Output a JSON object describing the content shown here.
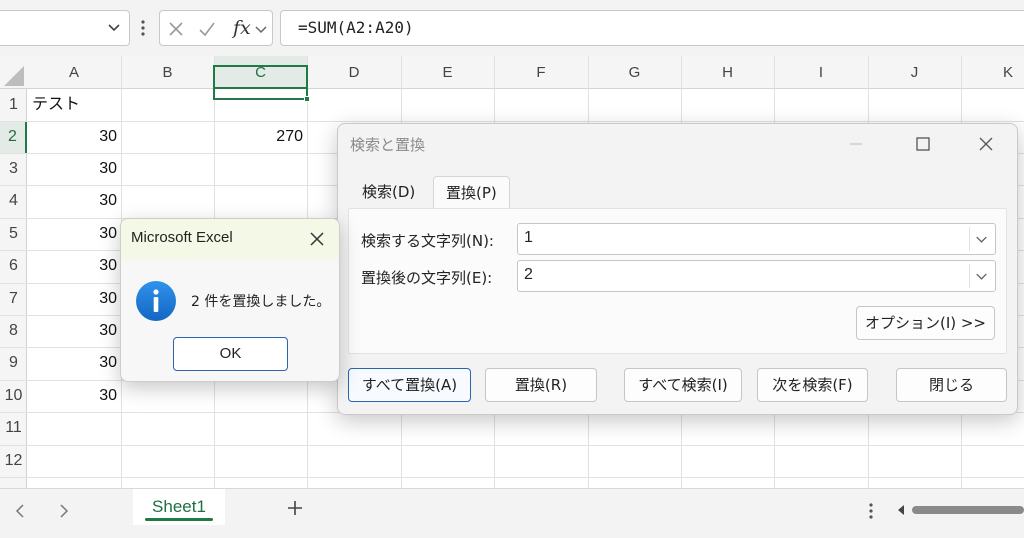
{
  "formula_bar": {
    "fx_label": "fx",
    "formula": "=SUM(A2:A20)"
  },
  "grid": {
    "columns": [
      "A",
      "B",
      "C",
      "D",
      "E",
      "F",
      "G",
      "H",
      "I",
      "J",
      "K"
    ],
    "rows": [
      "1",
      "2",
      "3",
      "4",
      "5",
      "6",
      "7",
      "8",
      "9",
      "10",
      "11",
      "12"
    ],
    "selected_column": "C",
    "selected_row": "2",
    "cells": {
      "A1": "テスト",
      "A2": "30",
      "A3": "30",
      "A4": "30",
      "A5": "30",
      "A6": "30",
      "A7": "30",
      "A8": "30",
      "A9": "30",
      "A10": "30",
      "C2": "270"
    }
  },
  "sheet_tabs": {
    "active": "Sheet1"
  },
  "find_replace": {
    "title": "検索と置換",
    "tab_find": "検索(D)",
    "tab_replace": "置換(P)",
    "find_label": "検索する文字列(N):",
    "find_value": "1",
    "replace_label": "置換後の文字列(E):",
    "replace_value": "2",
    "options_button": "オプション(I) >>",
    "replace_all_button": "すべて置換(A)",
    "replace_button": "置換(R)",
    "find_all_button": "すべて検索(I)",
    "find_next_button": "次を検索(F)",
    "close_button": "閉じる"
  },
  "message_box": {
    "title": "Microsoft Excel",
    "message": "2 件を置換しました。",
    "ok_button": "OK"
  },
  "colors": {
    "accent_green": "#1f7a45",
    "dialog_accent_blue": "#2b64b0",
    "info_icon_blue": "#1b78d4"
  }
}
